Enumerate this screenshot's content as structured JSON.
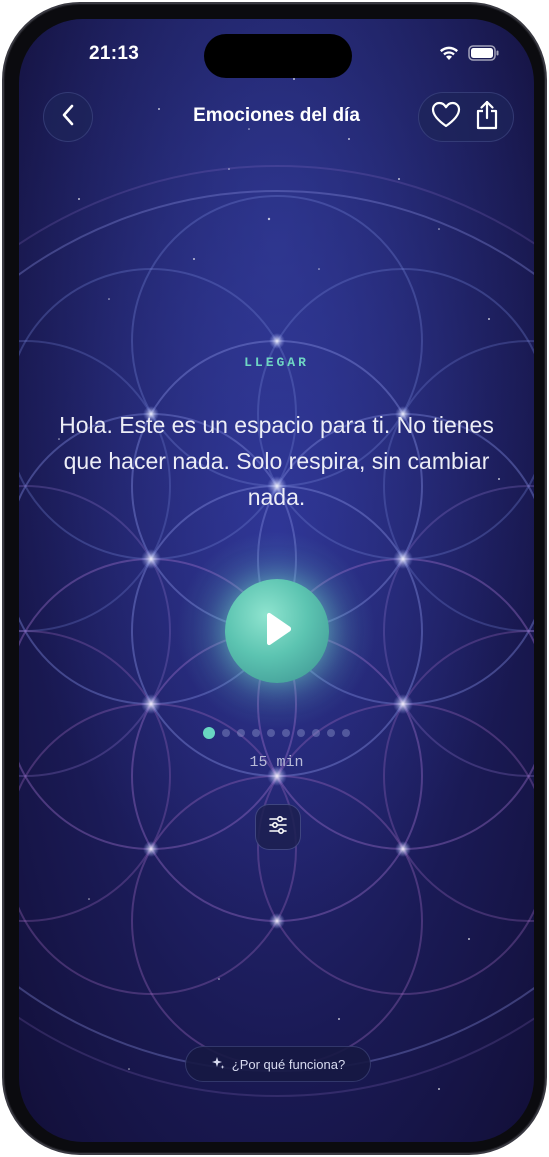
{
  "status_bar": {
    "time": "21:13"
  },
  "nav": {
    "title": "Emociones del día",
    "back_icon": "chevron-left-icon",
    "favorite_icon": "heart-icon",
    "share_icon": "share-icon"
  },
  "session": {
    "eyebrow": "LLEGAR",
    "text": "Hola. Este es un espacio para ti. No tienes que hacer nada. Solo respira, sin cambiar nada.",
    "play_icon": "play-icon",
    "steps_total": 10,
    "steps_current": 1,
    "duration": "15 min",
    "settings_icon": "sliders-icon"
  },
  "footer": {
    "why_label": "¿Por qué funciona?",
    "why_icon": "sparkle-icon"
  },
  "colors": {
    "accent": "#6fd6c3",
    "background": "#1f2270"
  }
}
